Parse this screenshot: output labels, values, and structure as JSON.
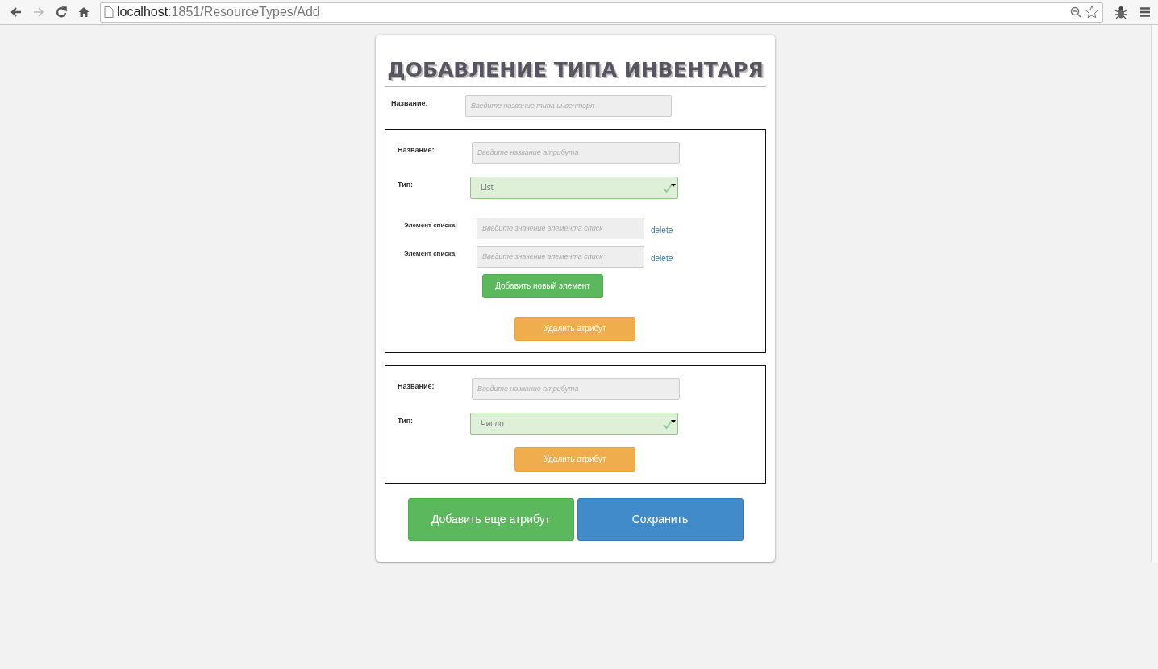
{
  "browser": {
    "nav_buttons": [
      {
        "kind": "back",
        "disabled": false
      },
      {
        "kind": "forward",
        "disabled": true
      },
      {
        "kind": "reload",
        "disabled": false
      },
      {
        "kind": "home",
        "disabled": false
      }
    ],
    "url_host": "localhost",
    "url_path": ":1851/ResourceTypes/Add"
  },
  "form": {
    "title": "ДОБАВЛЕНИЕ ТИПА ИНВЕНТАРЯ",
    "name_label": "Название:",
    "name_placeholder": "Введите название типа инвентаря",
    "attributes": [
      {
        "name_label": "Название:",
        "name_placeholder": "Введите название атрибута",
        "type_label": "Тип:",
        "type_value": "List",
        "list_items": [
          {
            "label": "Элемент списка:",
            "placeholder": "Введите значение элемента списк",
            "delete": "delete"
          },
          {
            "label": "Элемент списка:",
            "placeholder": "Введите значение элемента списк",
            "delete": "delete"
          }
        ],
        "add_item_button": "Добавить новый элемент",
        "delete_button": "Удалить атрибут"
      },
      {
        "name_label": "Название:",
        "name_placeholder": "Введите название атрибута",
        "type_label": "Тип:",
        "type_value": "Число",
        "delete_button": "Удалить атрибут"
      }
    ],
    "buttons": [
      {
        "kind": "add",
        "label": "Добавить еще атрибут"
      },
      {
        "kind": "save",
        "label": "Сохранить"
      }
    ]
  }
}
